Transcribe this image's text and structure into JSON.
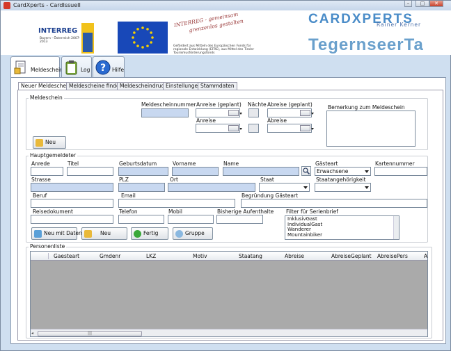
{
  "window": {
    "title": "CardXperts - CardIssueII",
    "controls": {
      "minimize": "–",
      "maximize": "□",
      "close": "✕"
    }
  },
  "banner": {
    "interreg_word": "INTERREG",
    "interreg_sub": "Bayern - Österreich 2007-2013",
    "slogan_line1": "INTERREG - gemeinsam",
    "slogan_line2": "grenzenlos gestalten",
    "funding_text": "Gefördert aus Mitteln des Europäischen Fonds für regionale Entwicklung (EFRE), aus Mittel des Tiroler Tourismusförderungsfonds",
    "brand_name": "CARDXPERTS",
    "brand_owner": "Rainer Kerner",
    "brand_region": "TegernseerTa"
  },
  "main_tabs": [
    {
      "label": "Meldeschein"
    },
    {
      "label": "Log"
    },
    {
      "label": "Hilfe"
    }
  ],
  "sub_tabs": [
    "Neuer Meldeschein",
    "Meldescheine finden",
    "Meldescheindruck",
    "Einstellungen",
    "Stammdaten"
  ],
  "meldeschein": {
    "group": "Meldeschein",
    "nummer_label": "Meldescheinnummer",
    "anreise_geplant_label": "Anreise (geplant)",
    "naechte_label": "Nächte",
    "abreise_geplant_label": "Abreise (geplant)",
    "anreise_label": "Anreise",
    "abreise_label": "Abreise",
    "bemerkung_label": "Bemerkung zum Meldeschein",
    "neu_button": "Neu"
  },
  "hauptgemeldeter": {
    "group": "Hauptgemeldeter",
    "anrede": "Anrede",
    "titel": "Titel",
    "geburtsdatum": "Geburtsdatum",
    "vorname": "Vorname",
    "name": "Name",
    "gaesteart": "Gästeart",
    "gaesteart_value": "Erwachsene",
    "kartennummer": "Kartennummer",
    "strasse": "Strasse",
    "plz": "PLZ",
    "ort": "Ort",
    "staat": "Staat",
    "staatsangehoerigkeit": "Staatangehörigkeit",
    "beruf": "Beruf",
    "email": "Email",
    "begruendung": "Begründung Gästeart",
    "reisedokument": "Reisedokument",
    "telefon": "Telefon",
    "mobil": "Mobil",
    "bisherige": "Bisherige Aufenthalte",
    "filter_label": "Filter für Serienbrief",
    "filter_items": [
      "InklusivGast",
      "IndividualGast",
      "Wanderer",
      "Mountainbiker"
    ]
  },
  "buttons": {
    "neu_mit_daten": "Neu mit Daten",
    "neu": "Neu",
    "fertig": "Fertig",
    "gruppe": "Gruppe"
  },
  "personenliste": {
    "group": "Personenliste",
    "columns": [
      "Gaesteart",
      "Gmdenr",
      "LKZ",
      "Motiv",
      "Staatang",
      "Abreise",
      "AbreiseGeplant",
      "AbreisePers",
      "An"
    ],
    "scroll_thumb": "|||"
  },
  "colors": {
    "required_field": "#c8d8f0",
    "brand_blue": "#4a8cc8",
    "eu_blue": "#1848b8"
  }
}
